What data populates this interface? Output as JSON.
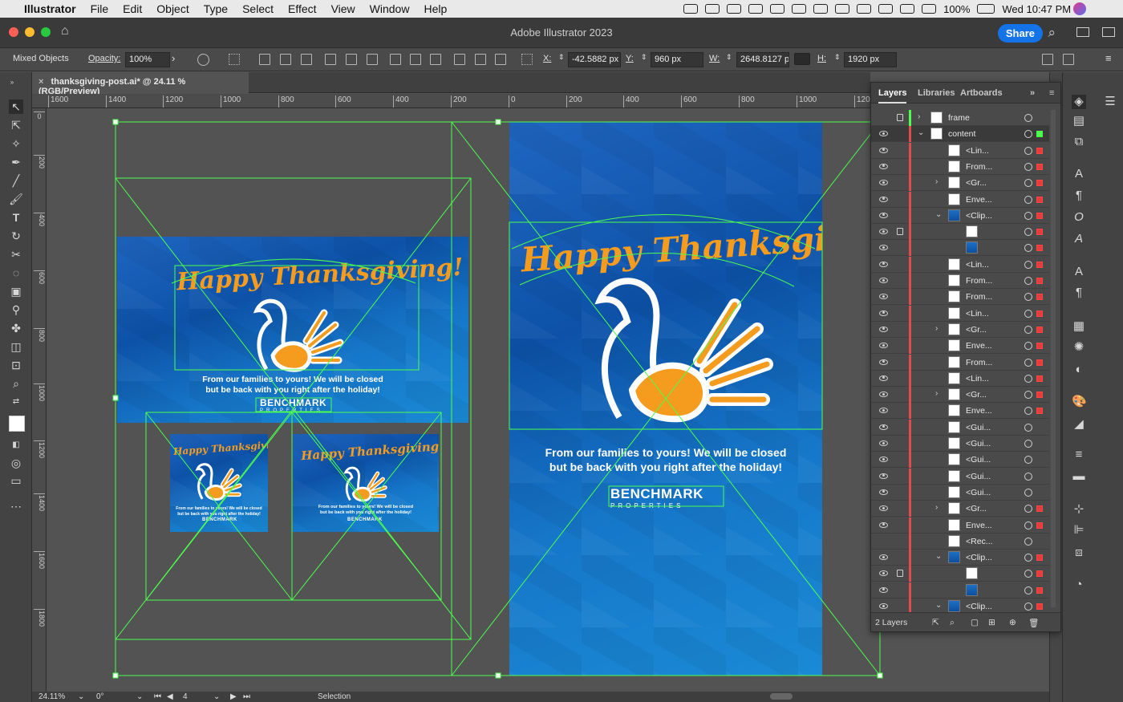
{
  "menubar": {
    "app": "Illustrator",
    "items": [
      "File",
      "Edit",
      "Object",
      "Type",
      "Select",
      "Effect",
      "View",
      "Window",
      "Help"
    ],
    "battery": "100%",
    "clock": "Wed 10:47 PM"
  },
  "window": {
    "title": "Adobe Illustrator 2023",
    "share": "Share"
  },
  "control": {
    "selection_type": "Mixed Objects",
    "opacity_label": "Opacity:",
    "opacity": "100%",
    "x_label": "X:",
    "x": "-42.5882 px",
    "y_label": "Y:",
    "y": "960 px",
    "w_label": "W:",
    "w": "2648.8127 p",
    "h_label": "H:",
    "h": "1920 px"
  },
  "doc_tab": "thanksgiving-post.ai* @ 24.11 % (RGB/Preview)",
  "ruler_h": [
    "1600",
    "1400",
    "1200",
    "1000",
    "800",
    "600",
    "400",
    "200",
    "0",
    "200",
    "400",
    "600",
    "800",
    "1000",
    "120"
  ],
  "ruler_v": [
    "0",
    "200",
    "400",
    "600",
    "800",
    "1000",
    "1200",
    "1400",
    "1600",
    "1800"
  ],
  "artwork": {
    "headline": "Happy Thanksgiving!",
    "message_line1": "From our families to yours! We will be closed",
    "message_line2": "but be back with you right after the holiday!",
    "logo_main": "BENCHMARK",
    "logo_sub": "PROPERTIES"
  },
  "layers_panel": {
    "tabs": [
      "Layers",
      "Libraries",
      "Artboards"
    ],
    "rows": [
      {
        "name": "frame",
        "level": 0,
        "eye": false,
        "lock": true,
        "chev": "›",
        "thumb": "frame"
      },
      {
        "name": "content",
        "level": 0,
        "eye": true,
        "lock": false,
        "chev": "⌄",
        "thumb": "content"
      },
      {
        "name": "<Lin...",
        "level": 1,
        "eye": true
      },
      {
        "name": "From...",
        "level": 1,
        "eye": true
      },
      {
        "name": "<Gr...",
        "level": 1,
        "eye": true,
        "chev": "›"
      },
      {
        "name": "Enve...",
        "level": 1,
        "eye": true
      },
      {
        "name": "<Clip...",
        "level": 1,
        "eye": true,
        "chev": "⌄",
        "blue": true
      },
      {
        "name": "",
        "level": 2,
        "eye": true,
        "lock": true
      },
      {
        "name": "",
        "level": 2,
        "eye": true,
        "blue": true
      },
      {
        "name": "<Lin...",
        "level": 1,
        "eye": true
      },
      {
        "name": "From...",
        "level": 1,
        "eye": true
      },
      {
        "name": "From...",
        "level": 1,
        "eye": true
      },
      {
        "name": "<Lin...",
        "level": 1,
        "eye": true
      },
      {
        "name": "<Gr...",
        "level": 1,
        "eye": true,
        "chev": "›"
      },
      {
        "name": "Enve...",
        "level": 1,
        "eye": true
      },
      {
        "name": "From...",
        "level": 1,
        "eye": true
      },
      {
        "name": "<Lin...",
        "level": 1,
        "eye": true
      },
      {
        "name": "<Gr...",
        "level": 1,
        "eye": true,
        "chev": "›"
      },
      {
        "name": "Enve...",
        "level": 1,
        "eye": true
      },
      {
        "name": "<Gui...",
        "level": 1,
        "eye": true
      },
      {
        "name": "<Gui...",
        "level": 1,
        "eye": true
      },
      {
        "name": "<Gui...",
        "level": 1,
        "eye": true
      },
      {
        "name": "<Gui...",
        "level": 1,
        "eye": true
      },
      {
        "name": "<Gui...",
        "level": 1,
        "eye": true
      },
      {
        "name": "<Gr...",
        "level": 1,
        "eye": true,
        "chev": "›"
      },
      {
        "name": "Enve...",
        "level": 1,
        "eye": true
      },
      {
        "name": "<Rec...",
        "level": 1,
        "eye": false
      },
      {
        "name": "<Clip...",
        "level": 1,
        "eye": true,
        "chev": "⌄",
        "blue": true
      },
      {
        "name": "",
        "level": 2,
        "eye": true,
        "lock": true
      },
      {
        "name": "",
        "level": 2,
        "eye": true,
        "blue": true
      },
      {
        "name": "<Clip...",
        "level": 1,
        "eye": true,
        "chev": "⌄",
        "blue": true
      }
    ],
    "footer": "2 Layers"
  },
  "status": {
    "zoom": "24.11%",
    "rotation": "0°",
    "artboard": "4",
    "tool": "Selection"
  },
  "colors": {
    "accent": "#1473e6",
    "selection": "#4cff4c",
    "orange": "#f59b1e"
  }
}
